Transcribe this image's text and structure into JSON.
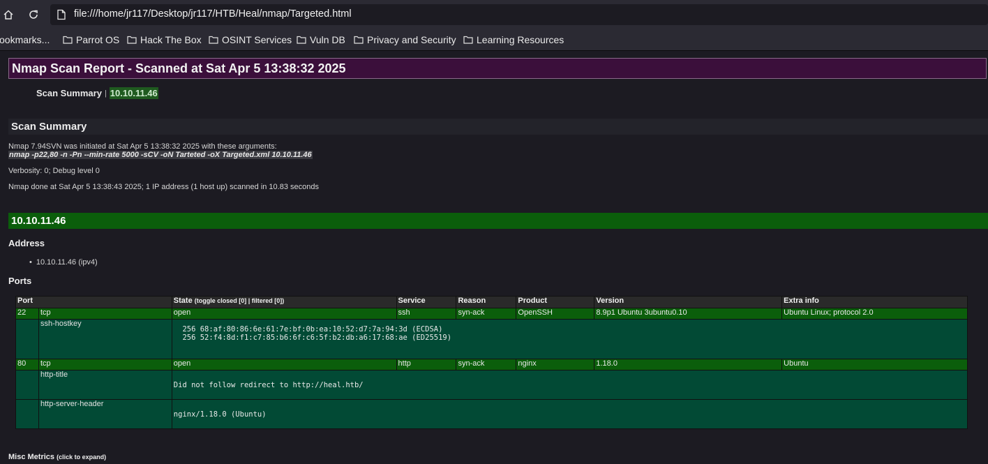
{
  "browser": {
    "url": "file:///home/jr117/Desktop/jr117/HTB/Heal/nmap/Targeted.html",
    "bookmarks": [
      "ookmarks...",
      "Parrot OS",
      "Hack The Box",
      "OSINT Services",
      "Vuln DB",
      "Privacy and Security",
      "Learning Resources"
    ]
  },
  "report": {
    "title": "Nmap Scan Report - Scanned at Sat Apr 5 13:38:32 2025",
    "nav": {
      "summary_link": "Scan Summary",
      "separator": "|",
      "ip_link": "10.10.11.46"
    }
  },
  "summary": {
    "heading": "Scan Summary",
    "initiated": "Nmap 7.94SVN was initiated at Sat Apr 5 13:38:32 2025 with these arguments:",
    "arguments": "nmap -p22,80 -n -Pn --min-rate 5000 -sCV -oN Tarteted -oX Targeted.xml 10.10.11.46",
    "verbosity": "Verbosity: 0; Debug level 0",
    "done": "Nmap done at Sat Apr 5 13:38:43 2025; 1 IP address (1 host up) scanned in 10.83 seconds"
  },
  "host": {
    "ip": "10.10.11.46",
    "address_heading": "Address",
    "address": "10.10.11.46 (ipv4)",
    "ports_heading": "Ports"
  },
  "ports_table": {
    "headers": {
      "port": "Port",
      "state": "State",
      "state_toggle": "(toggle closed [0] | filtered [0])",
      "service": "Service",
      "reason": "Reason",
      "product": "Product",
      "version": "Version",
      "extra": "Extra info"
    },
    "rows": [
      {
        "port": "22",
        "proto": "tcp",
        "state": "open",
        "service": "ssh",
        "reason": "syn-ack",
        "product": "OpenSSH",
        "version": "8.9p1 Ubuntu 3ubuntu0.10",
        "extra": "Ubuntu Linux; protocol 2.0",
        "scripts": [
          {
            "name": "ssh-hostkey",
            "output": "\n  256 68:af:80:86:6e:61:7e:bf:0b:ea:10:52:d7:7a:94:3d (ECDSA)\n  256 52:f4:8d:f1:c7:85:b6:6f:c6:5f:b2:db:a6:17:68:ae (ED25519)\n"
          }
        ]
      },
      {
        "port": "80",
        "proto": "tcp",
        "state": "open",
        "service": "http",
        "reason": "syn-ack",
        "product": "nginx",
        "version": "1.18.0",
        "extra": "Ubuntu",
        "scripts": [
          {
            "name": "http-title",
            "output": "Did not follow redirect to http://heal.htb/"
          },
          {
            "name": "http-server-header",
            "output": "nginx/1.18.0 (Ubuntu)"
          }
        ]
      }
    ]
  },
  "misc": {
    "label": "Misc Metrics",
    "hint": "(click to expand)"
  }
}
